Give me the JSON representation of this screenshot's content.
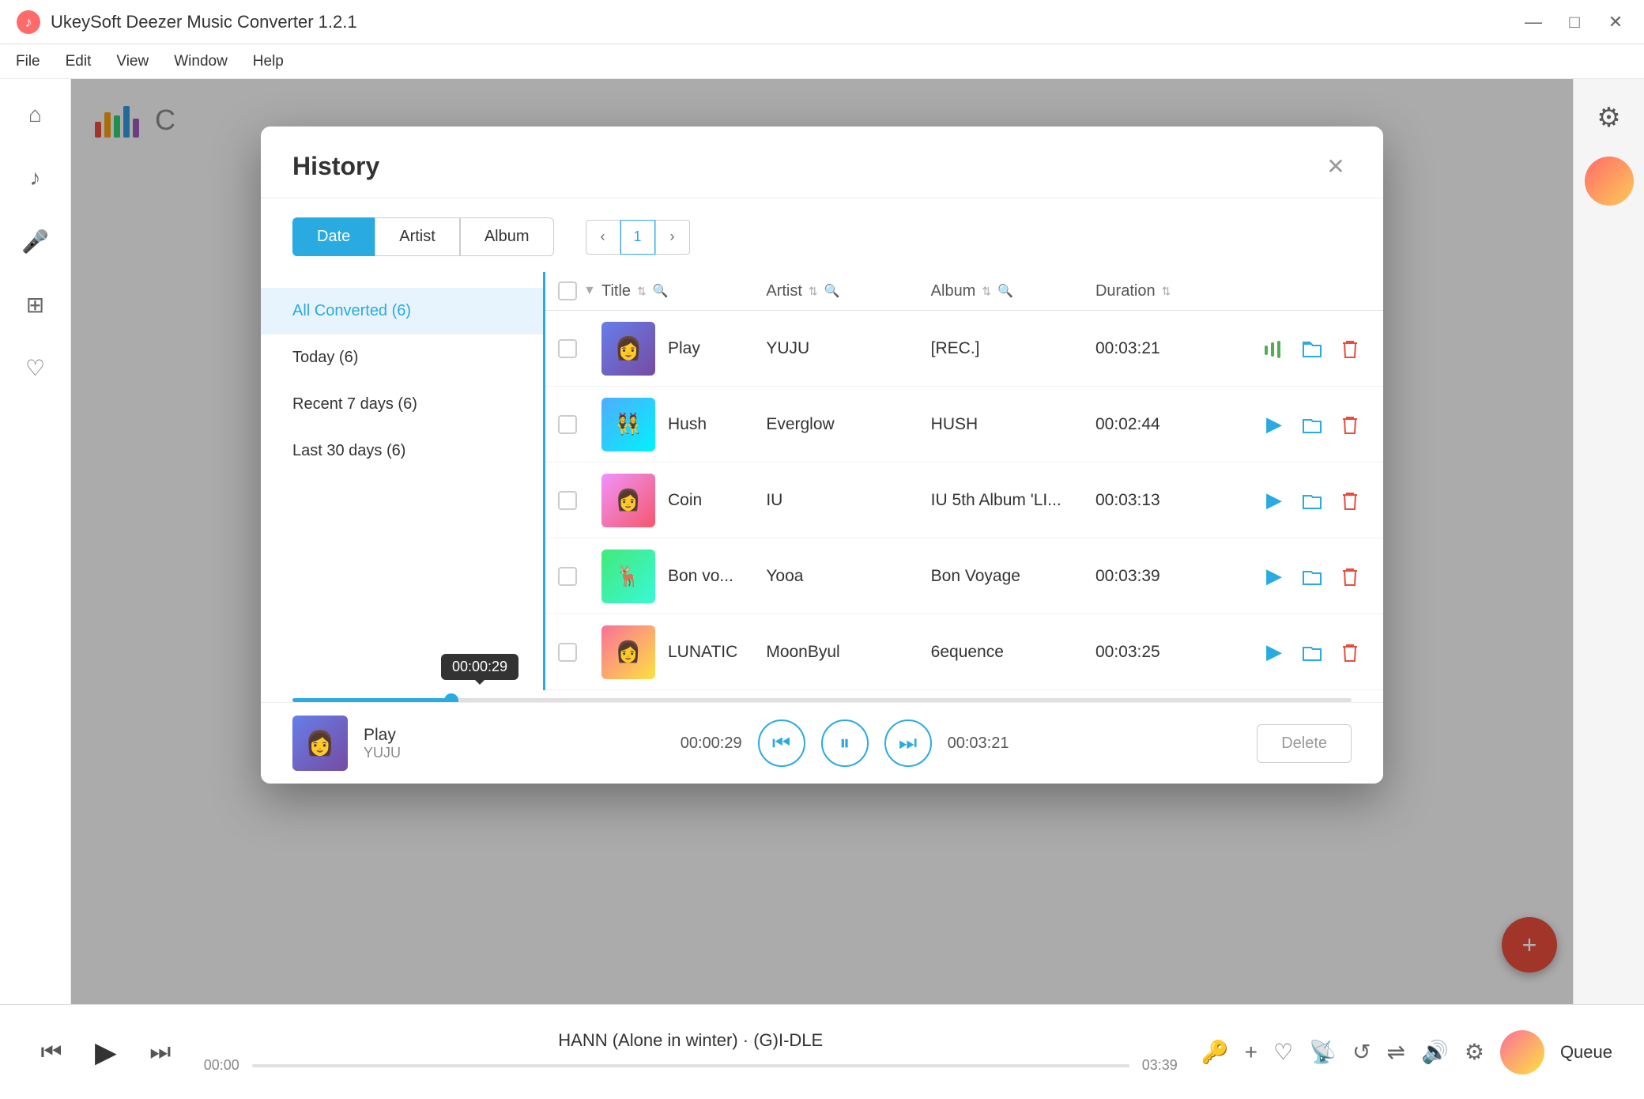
{
  "window": {
    "title": "UkeySoft Deezer Music Converter 1.2.1",
    "controls": {
      "minimize": "—",
      "maximize": "□",
      "close": "✕"
    }
  },
  "menubar": {
    "items": [
      "File",
      "Edit",
      "View",
      "Window",
      "Help"
    ]
  },
  "sidebar": {
    "icons": [
      {
        "name": "home",
        "symbol": "⌂",
        "active": false
      },
      {
        "name": "music-note",
        "symbol": "♪",
        "active": false
      },
      {
        "name": "microphone",
        "symbol": "🎤",
        "active": false
      },
      {
        "name": "grid",
        "symbol": "⊞",
        "active": false
      },
      {
        "name": "heart",
        "symbol": "♡",
        "active": false
      }
    ]
  },
  "modal": {
    "title": "History",
    "close_label": "✕",
    "filter_tabs": [
      {
        "label": "Date",
        "active": true
      },
      {
        "label": "Artist",
        "active": false
      },
      {
        "label": "Album",
        "active": false
      }
    ],
    "pagination": {
      "prev": "‹",
      "current": "1",
      "next": "›"
    },
    "date_filters": [
      {
        "label": "All Converted (6)",
        "active": true
      },
      {
        "label": "Today (6)",
        "active": false
      },
      {
        "label": "Recent 7 days (6)",
        "active": false
      },
      {
        "label": "Last 30 days (6)",
        "active": false
      }
    ],
    "table": {
      "headers": [
        {
          "label": "Title",
          "sortable": true,
          "searchable": true
        },
        {
          "label": "Artist",
          "sortable": true,
          "searchable": true
        },
        {
          "label": "Album",
          "sortable": true,
          "searchable": true
        },
        {
          "label": "Duration",
          "sortable": true,
          "searchable": false
        }
      ],
      "rows": [
        {
          "title": "Play",
          "artist": "YUJU",
          "album": "[REC.]",
          "duration": "00:03:21",
          "thumb_color1": "#667eea",
          "thumb_color2": "#764ba2",
          "playing": true
        },
        {
          "title": "Hush",
          "artist": "Everglow",
          "album": "HUSH",
          "duration": "00:02:44",
          "thumb_color1": "#4facfe",
          "thumb_color2": "#00f2fe",
          "playing": false
        },
        {
          "title": "Coin",
          "artist": "IU",
          "album": "IU 5th Album 'LI...",
          "duration": "00:03:13",
          "thumb_color1": "#f093fb",
          "thumb_color2": "#f5576c",
          "playing": false
        },
        {
          "title": "Bon vo...",
          "artist": "Yooa",
          "album": "Bon Voyage",
          "duration": "00:03:39",
          "thumb_color1": "#43e97b",
          "thumb_color2": "#38f9d7",
          "playing": false
        },
        {
          "title": "LUNATIC",
          "artist": "MoonByul",
          "album": "6equence",
          "duration": "00:03:25",
          "thumb_color1": "#fa709a",
          "thumb_color2": "#fee140",
          "playing": false
        }
      ]
    },
    "player": {
      "song": "Play",
      "artist": "YUJU",
      "current_time": "00:00:29",
      "total_time": "00:03:21",
      "progress_percent": "15",
      "tooltip": "00:00:29",
      "delete_label": "Delete"
    }
  },
  "bottom_player": {
    "song_title": "HANN (Alone in winter) · (G)I-DLE",
    "time_start": "00:00",
    "time_end": "03:39",
    "queue_label": "Queue",
    "controls": {
      "prev": "⏮",
      "play": "▶",
      "next": "⏭",
      "key_icon": "🔑",
      "plus_icon": "+",
      "heart_icon": "♡",
      "cast_icon": "📡",
      "repeat_icon": "↺",
      "shuffle_icon": "⇌",
      "volume_icon": "🔊",
      "settings_icon": "⚙"
    }
  },
  "colors": {
    "accent": "#29aae1",
    "delete_red": "#e74c3c",
    "play_green": "#4caf50",
    "active_blue": "#29aae1"
  }
}
